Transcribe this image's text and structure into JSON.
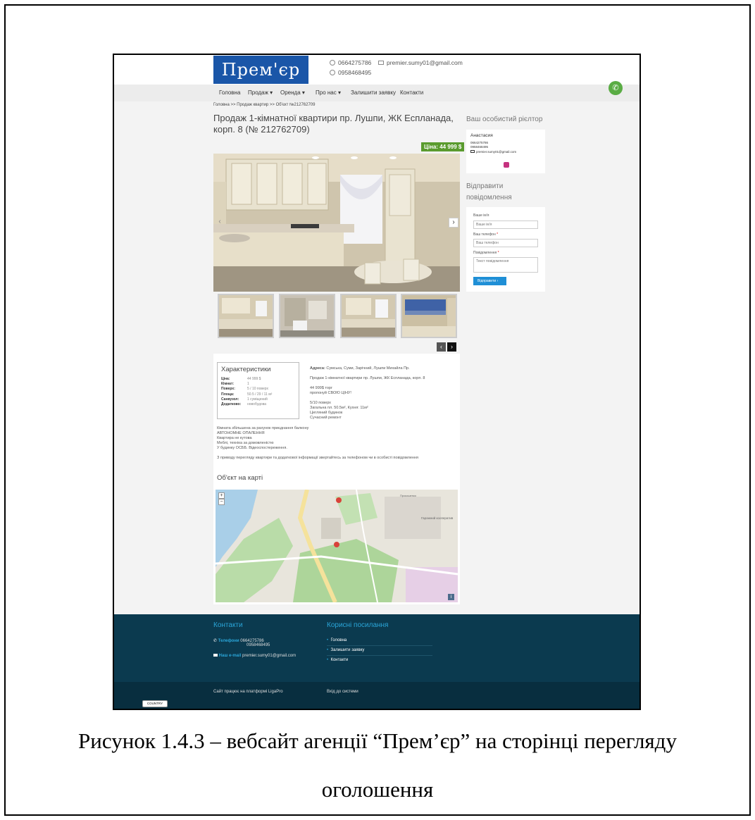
{
  "header": {
    "logo_text": "Прем'єр",
    "phone_1": "0664275786",
    "phone_2": "0958468495",
    "email": "premier.sumy01@gmail.com"
  },
  "nav": {
    "items": [
      "Головна",
      "Продаж ▾",
      "Оренда ▾",
      "Про нас ▾",
      "Залишити заявку",
      "Контакти"
    ]
  },
  "breadcrumb": "Головна >> Продаж квартир >> Об'єкт №212762709",
  "listing": {
    "title": "Продаж 1-кімнатної квартири пр. Лушпи, ЖК Еспланада, корп. 8  (№ 212762709)",
    "price_badge": "Ціна: 44 999 $"
  },
  "characteristics": {
    "heading": "Характеристики",
    "rows": [
      {
        "label": "Ціна:",
        "value": "44 999 $"
      },
      {
        "label": "Кімнат:",
        "value": "1"
      },
      {
        "label": "Поверх:",
        "value": "5 / 10 поверх"
      },
      {
        "label": "Площа:",
        "value": "50.5 / 29 / 11 м²"
      },
      {
        "label": "Санвузол:",
        "value": "1 суміщений"
      },
      {
        "label": "Додатково:",
        "value": "новобудова"
      }
    ]
  },
  "address": {
    "label": "Адреса:",
    "value": "Сумська, Суми, Зарічний, Лушпи Михайла Пр.",
    "line2": "Продаж 1-кімнатної квартири пр. Лушпи, ЖК Еспланада, корп. 8",
    "line3": "44 999$ торг",
    "line4": "пропонуй СВОЮ ЦІНУ!",
    "line5": "5/10 поверх",
    "line6": "Загальна пл. 50.5м², Кухня: 11м²",
    "line7": "Цегляний будинок",
    "line8": "Сучасний ремонт"
  },
  "description": {
    "line1": "Кімната збільшена за рахунок приєднання балкону",
    "line2": "АВТОНОМНЕ ОПАЛЕННЯ",
    "line3": "Квартира не кутова",
    "line4": "Меблі, техніка за домовленістю",
    "line5": "У будинку ОСББ. Відеоспостереження.",
    "line6": "З приводу перегляду квартири та додаткової інформації звертайтесь за телефоном чи в особисті повідомлення"
  },
  "map": {
    "heading": "Об'єкт на карті",
    "label_1": "Прокошенко",
    "label_2": "Гаражний кооператив",
    "zoom_in": "+",
    "zoom_out": "−",
    "info": "i"
  },
  "sidebar": {
    "realtor_heading": "Ваш особистий рієлтор",
    "realtor_name": "Анастасия",
    "realtor_phone_1": "0664275786",
    "realtor_phone_2": "0958468495",
    "realtor_email": "premier.sumy01@gmail.com",
    "message_heading": "Відправити повідомлення",
    "name_label": "Ваше ім'я",
    "name_placeholder": "Ваше ім'я",
    "phone_label": "Ваш телефон",
    "phone_placeholder": "Ваш телефон",
    "message_label": "Повідомлення",
    "message_placeholder": "Текст повідомлення",
    "send_button": "Відправити",
    "required_mark": "*"
  },
  "footer": {
    "contacts_heading": "Контакти",
    "phones_label": "Телефони",
    "phone_1": "0664275786",
    "phone_2": "0958468495",
    "email_label": "Наш e-mail",
    "email": "premier.sumy01@gmail.com",
    "links_heading": "Корисні посилання",
    "links": [
      "Головна",
      "Залишити заявку",
      "Контакти"
    ],
    "platform_text": "Сайт працює на платформі LigaPro",
    "login_text": "Вхід до системи",
    "country_badge": "COUNTRY"
  },
  "caption": {
    "line1": "Рисунок 1.4.3 – вебсайт агенції “Прем’єр” на сторінці перегляду",
    "line2": "оголошення"
  },
  "colors": {
    "logo_bg": "#1a56a8",
    "price_green": "#5a9b2e",
    "call_green": "#5aac44",
    "send_blue": "#1f8fd6",
    "footer_bg": "#0b3a4f",
    "footer_heading": "#2aa5d8"
  }
}
